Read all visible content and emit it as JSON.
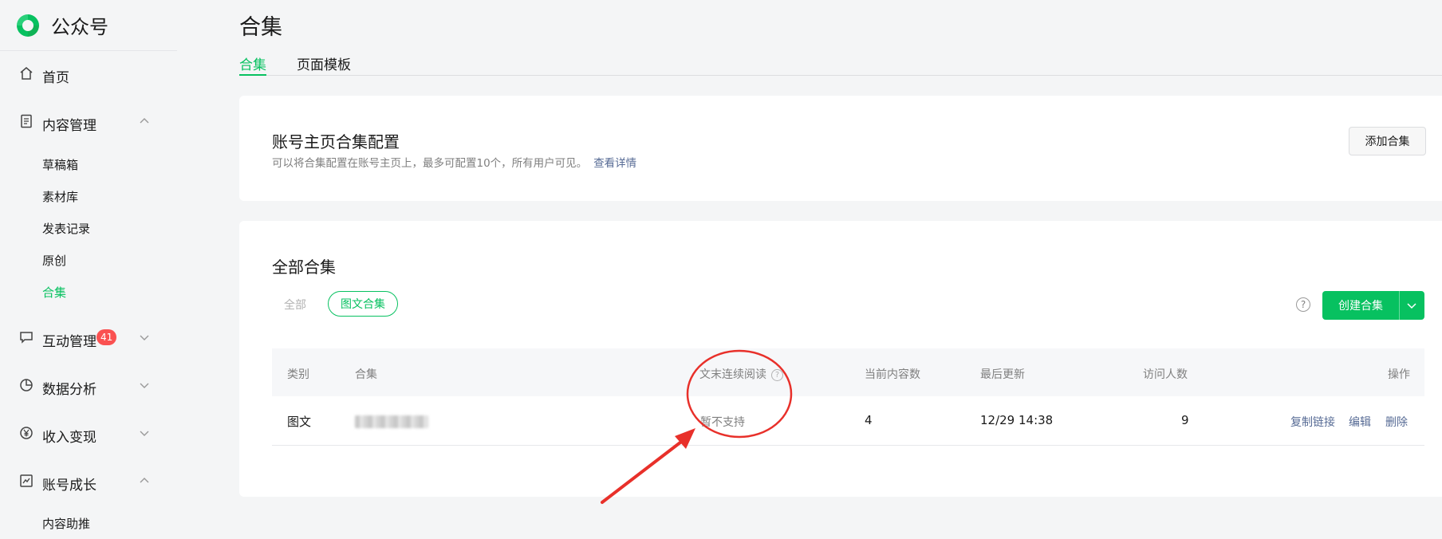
{
  "brand": {
    "name": "公众号"
  },
  "sidebar": {
    "items": [
      {
        "label": "首页"
      },
      {
        "label": "内容管理"
      },
      {
        "label": "互动管理",
        "badge": "41"
      },
      {
        "label": "数据分析"
      },
      {
        "label": "收入变现"
      },
      {
        "label": "账号成长"
      }
    ],
    "content_sub": [
      "草稿箱",
      "素材库",
      "发表记录",
      "原创",
      "合集"
    ],
    "growth_sub": [
      "内容助推"
    ]
  },
  "page": {
    "title": "合集",
    "tabs": [
      "合集",
      "页面模板"
    ]
  },
  "config_card": {
    "title": "账号主页合集配置",
    "desc": "可以将合集配置在账号主页上，最多可配置10个，所有用户可见。",
    "link": "查看详情",
    "add_button": "添加合集"
  },
  "all_card": {
    "title": "全部合集",
    "filter_all": "全部",
    "filter_active": "图文合集",
    "help": "?",
    "create_button": "创建合集"
  },
  "table": {
    "headers": [
      "类别",
      "合集",
      "文末连续阅读",
      "当前内容数",
      "最后更新",
      "访问人数",
      "操作"
    ],
    "header_help": "?",
    "row": {
      "type": "图文",
      "continuous": "暂不支持",
      "count": "4",
      "updated": "12/29 14:38",
      "visitors": "9",
      "ops": [
        "复制链接",
        "编辑",
        "删除"
      ]
    }
  },
  "colors": {
    "accent": "#07c160",
    "link": "#576b95",
    "badge": "#fa5151",
    "annotation": "#e8302a"
  }
}
